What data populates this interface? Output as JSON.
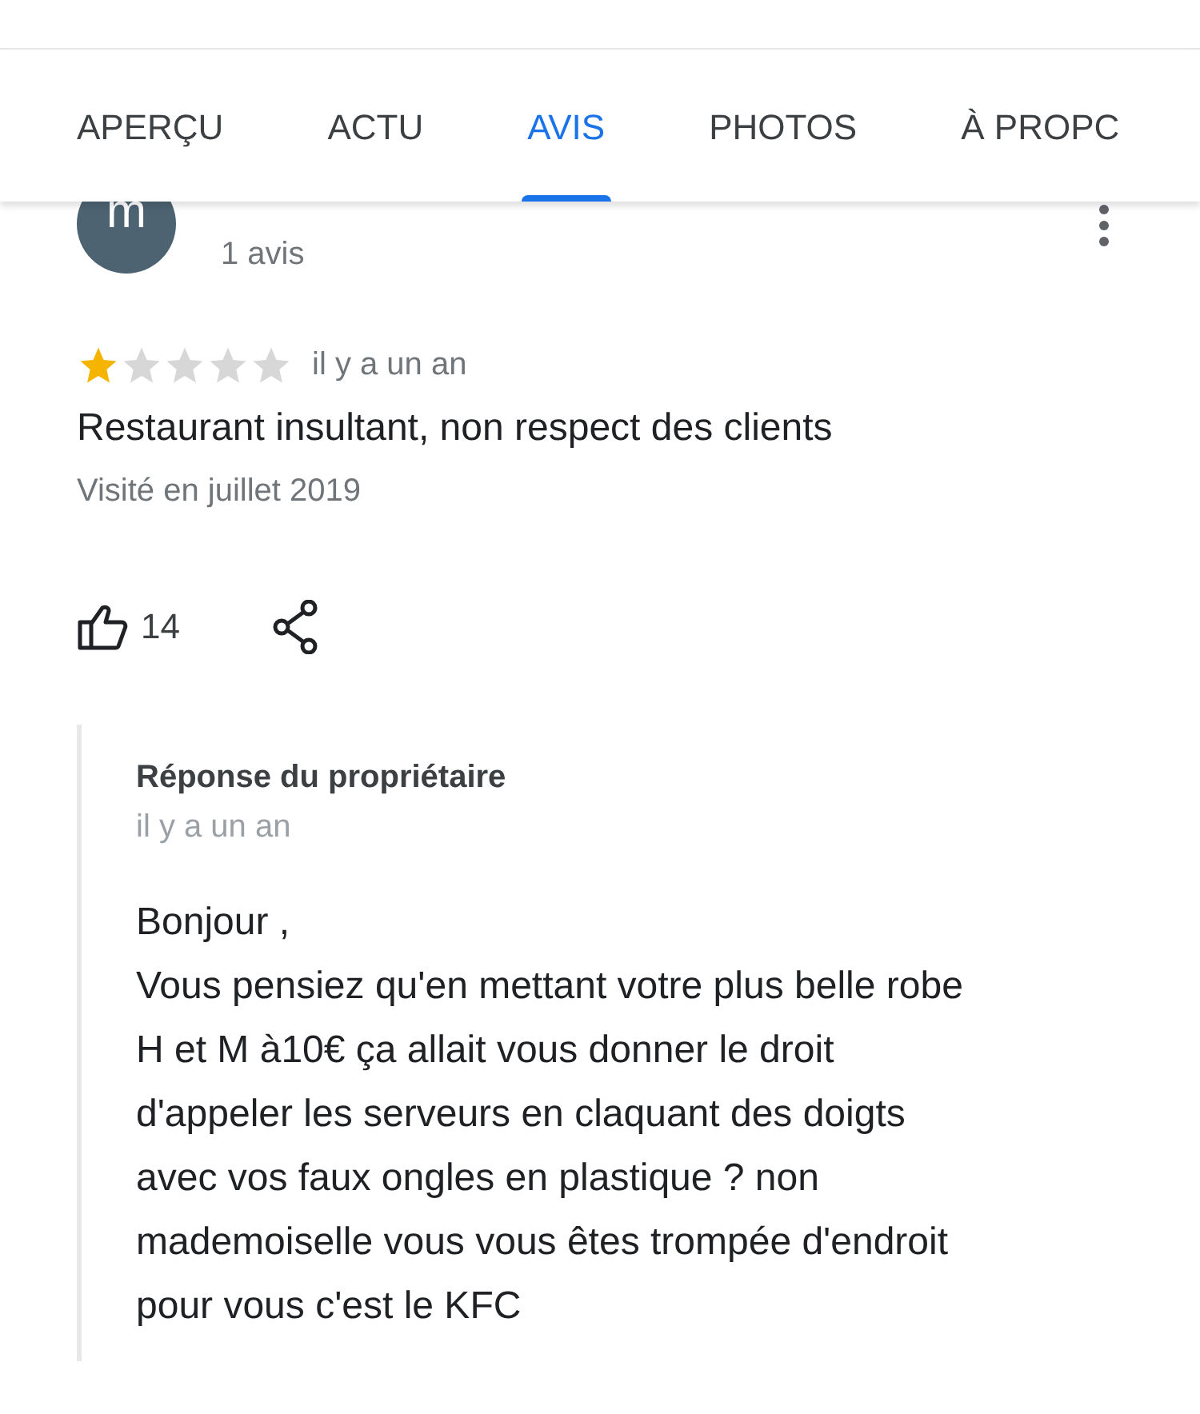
{
  "tabs": [
    {
      "label": "APERÇU",
      "selected": false
    },
    {
      "label": "ACTU",
      "selected": false
    },
    {
      "label": "AVIS",
      "selected": true
    },
    {
      "label": "PHOTOS",
      "selected": false
    },
    {
      "label": "À PROPC",
      "selected": false
    }
  ],
  "review": {
    "avatar_letter": "m",
    "review_count": "1 avis",
    "stars": 1,
    "time": "il y a un an",
    "text": "Restaurant insultant, non respect des clients",
    "visited": "Visité en juillet 2019",
    "likes": "14"
  },
  "owner_response": {
    "title": "Réponse du propriétaire",
    "time": "il y a un an",
    "text": "Bonjour ,\nVous pensiez qu'en mettant votre plus belle robe\nH et M à10€ ça allait vous donner le droit\nd'appeler les serveurs en claquant des doigts\navec vos faux ongles en plastique ? non\nmademoiselle vous vous êtes trompée d'endroit\npour vous c'est le KFC"
  }
}
